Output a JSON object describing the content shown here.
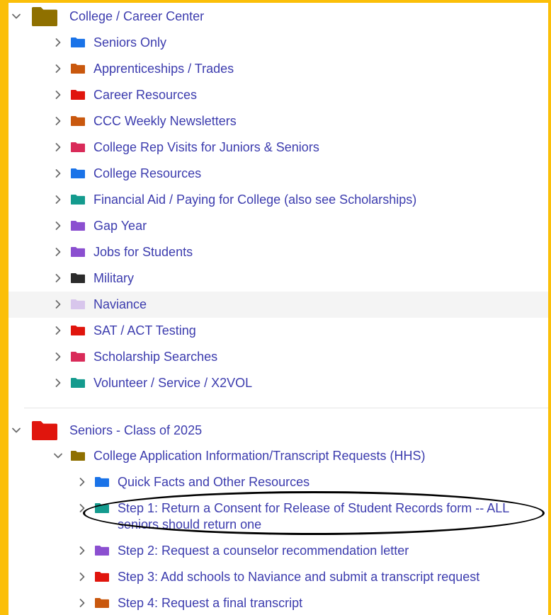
{
  "sections": [
    {
      "title": "College / Career Center",
      "folder_color": "#8f7000",
      "expanded": true,
      "items": [
        {
          "label": "Seniors Only",
          "color": "#1a73e8"
        },
        {
          "label": "Apprenticeships / Trades",
          "color": "#c9580e"
        },
        {
          "label": "Career Resources",
          "color": "#e0150d"
        },
        {
          "label": "CCC Weekly Newsletters",
          "color": "#c9580e"
        },
        {
          "label": "College Rep Visits for Juniors & Seniors",
          "color": "#d92b59"
        },
        {
          "label": "College Resources",
          "color": "#1a73e8"
        },
        {
          "label": "Financial Aid / Paying for College (also see Scholarships)",
          "color": "#149b8e"
        },
        {
          "label": "Gap Year",
          "color": "#8b4fd0"
        },
        {
          "label": "Jobs for Students",
          "color": "#8b4fd0"
        },
        {
          "label": "Military",
          "color": "#2b2b2b"
        },
        {
          "label": "Naviance",
          "color": "#d8c6ec",
          "highlighted": true
        },
        {
          "label": "SAT / ACT Testing",
          "color": "#e0150d"
        },
        {
          "label": "Scholarship Searches",
          "color": "#d92b59"
        },
        {
          "label": "Volunteer / Service / X2VOL",
          "color": "#149b8e"
        }
      ]
    },
    {
      "title": "Seniors - Class of 2025",
      "folder_color": "#e0150d",
      "expanded": true,
      "subfolder": {
        "label": "College Application Information/Transcript Requests (HHS)",
        "color": "#8f7000",
        "expanded": true,
        "items": [
          {
            "label": "Quick Facts and Other Resources",
            "color": "#1a73e8"
          },
          {
            "label": "Step 1: Return a Consent for Release of Student Records form -- ALL seniors should return one",
            "color": "#149b8e",
            "circled": true
          },
          {
            "label": "Step 2: Request a counselor recommendation letter",
            "color": "#8b4fd0"
          },
          {
            "label": "Step 3: Add schools to Naviance and submit a transcript request",
            "color": "#e0150d"
          },
          {
            "label": "Step 4: Request a final transcript",
            "color": "#c9580e"
          }
        ]
      }
    }
  ]
}
